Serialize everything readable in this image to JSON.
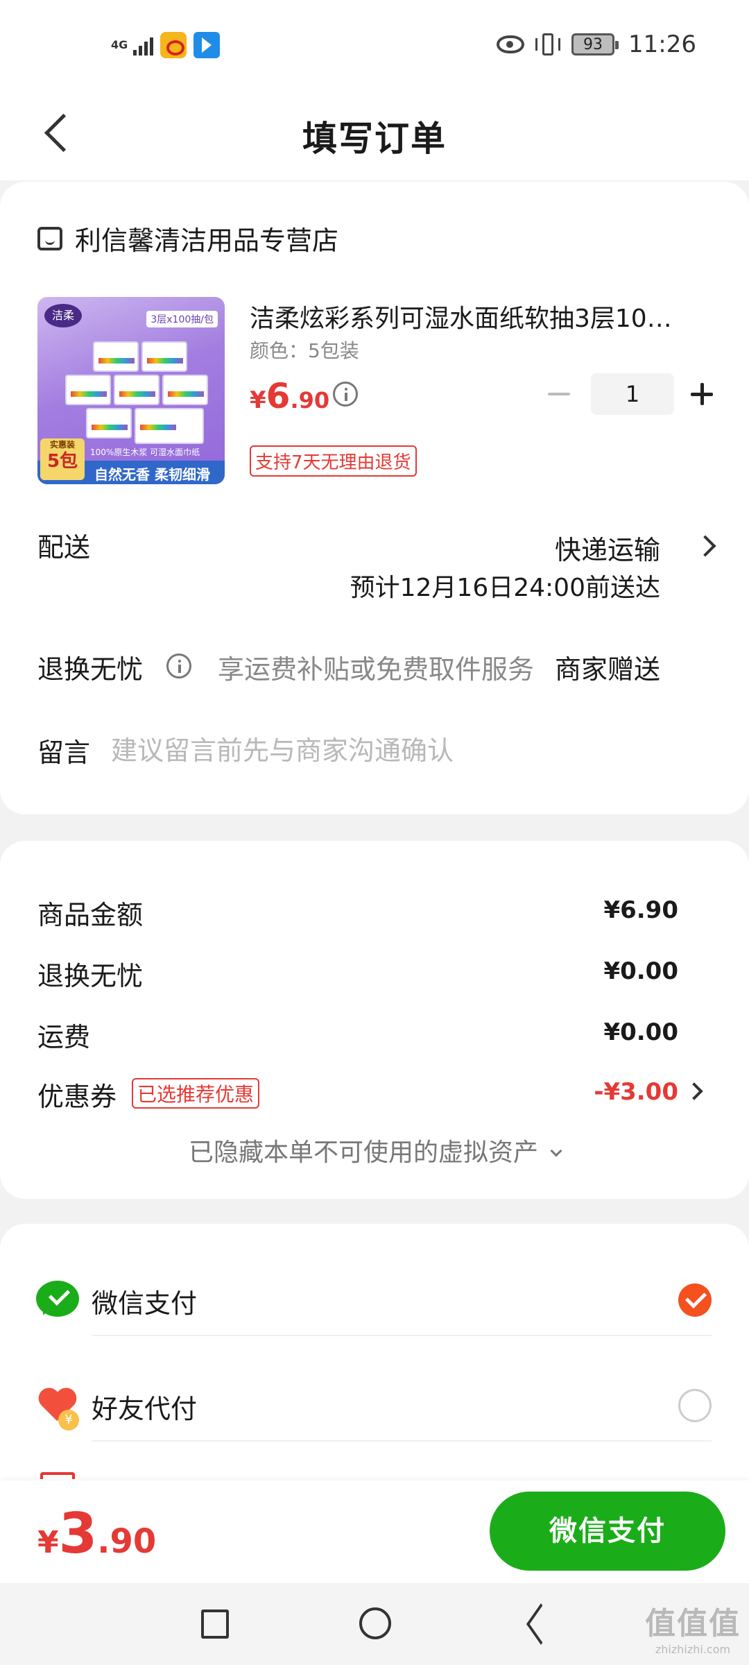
{
  "status_bar": {
    "network": "4G",
    "battery": "93",
    "time": "11:26"
  },
  "header": {
    "title": "填写订单"
  },
  "order": {
    "shop_name": "利信馨清洁用品专营店",
    "product": {
      "title": "洁柔炫彩系列可湿水面纸软抽3层10…",
      "spec": "颜色：5包装",
      "price_symbol": "¥",
      "price_int": "6",
      "price_dec": ".90",
      "quantity": "1",
      "return_tag": "支持7天无理由退货",
      "image_texts": {
        "tag": "3层x100抽/包",
        "pack_label": "实惠装",
        "pack_count": "5包",
        "small_line": "100%原生木浆 可湿水面巾纸",
        "slogan": "自然无香 柔韧细滑"
      }
    },
    "delivery": {
      "label": "配送",
      "method": "快递运输",
      "eta": "预计12月16日24:00前送达"
    },
    "worry_free": {
      "label": "退换无忧",
      "desc": "享运费补贴或免费取件服务",
      "value": "商家赠送"
    },
    "note": {
      "label": "留言",
      "placeholder": "建议留言前先与商家沟通确认"
    }
  },
  "summary": {
    "rows": [
      {
        "label": "商品金额",
        "value": "¥6.90"
      },
      {
        "label": "退换无忧",
        "value": "¥0.00"
      },
      {
        "label": "运费",
        "value": "¥0.00"
      },
      {
        "label": "优惠券",
        "tag": "已选推荐优惠",
        "value": "-¥3.00"
      }
    ],
    "hidden_assets": "已隐藏本单不可使用的虚拟资产"
  },
  "payment": {
    "methods": [
      {
        "label": "微信支付",
        "icon": "wechat-pay-icon",
        "selected": true
      },
      {
        "label": "好友代付",
        "icon": "friend-pay-heart-icon",
        "selected": false
      }
    ],
    "friend_badge": "¥"
  },
  "footer": {
    "total_symbol": "¥",
    "total_int": "3",
    "total_dec": ".90",
    "pay_button": "微信支付"
  },
  "watermark": {
    "big": "值值值",
    "small": "zhizhizhi.com"
  },
  "colors": {
    "accent_red": "#e53935",
    "wechat_green": "#1aad19",
    "selected_orange": "#f4511e"
  }
}
